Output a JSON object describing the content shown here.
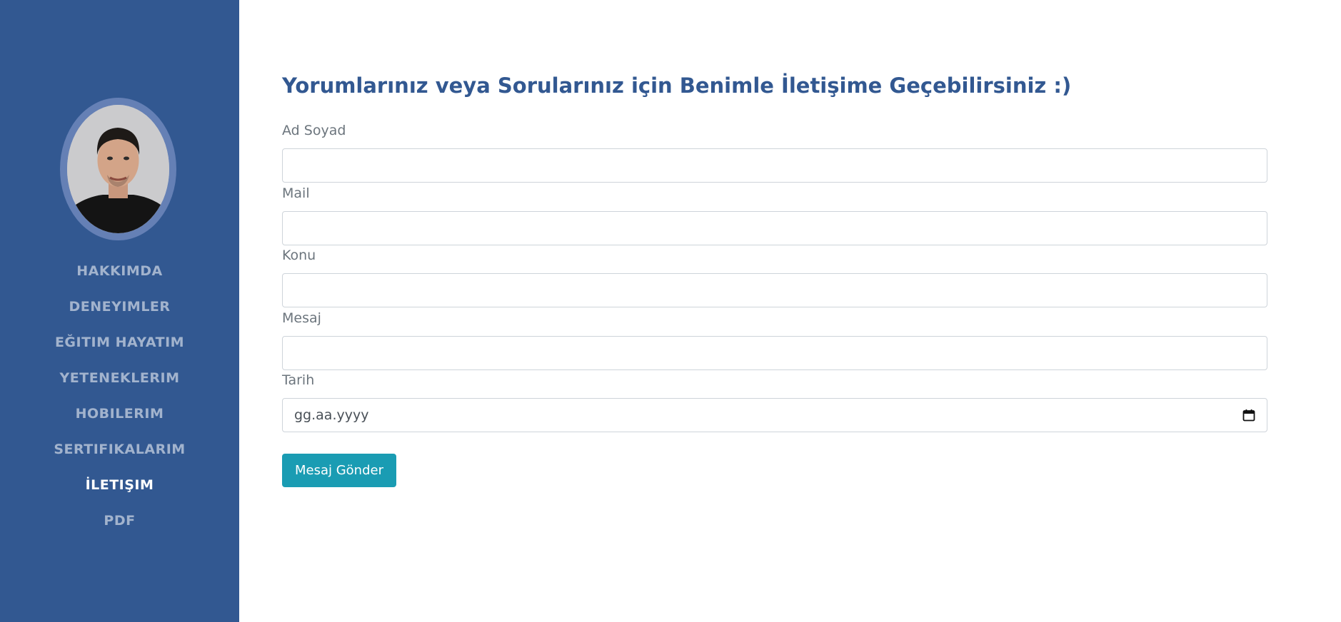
{
  "sidebar": {
    "avatar_alt": "profile photo",
    "nav": [
      {
        "label": "HAKKIMDA",
        "active": false
      },
      {
        "label": "DENEYIMLER",
        "active": false
      },
      {
        "label": "EĞITIM HAYATIM",
        "active": false
      },
      {
        "label": "YETENEKLERIM",
        "active": false
      },
      {
        "label": "HOBILERIM",
        "active": false
      },
      {
        "label": "SERTIFIKALARIM",
        "active": false
      },
      {
        "label": "İLETIŞIM",
        "active": true
      },
      {
        "label": "PDF",
        "active": false
      }
    ]
  },
  "contact": {
    "title": "Yorumlarınız veya Sorularınız için Benimle İletişime Geçebilirsiniz :)",
    "fields": {
      "name_label": "Ad Soyad",
      "mail_label": "Mail",
      "subject_label": "Konu",
      "message_label": "Mesaj",
      "date_label": "Tarih",
      "date_placeholder": "gg.aa.yyyy"
    },
    "submit_label": "Mesaj Gönder"
  },
  "colors": {
    "sidebar_bg": "#325891",
    "title": "#325891",
    "button": "#1a9cb3"
  },
  "icons": {
    "date": "calendar-icon"
  }
}
